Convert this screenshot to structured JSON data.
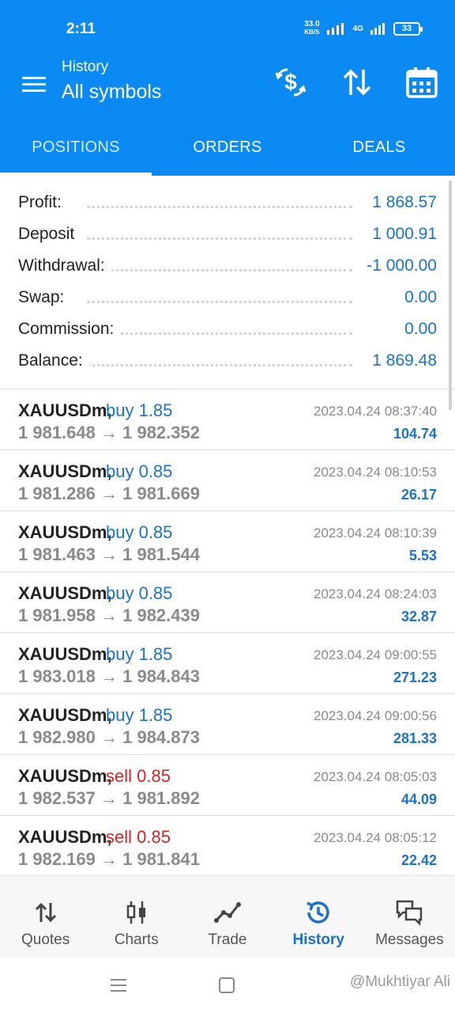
{
  "status_bar": {
    "time": "2:11",
    "net_speed": "33.0",
    "net_unit": "KB/S",
    "network": "4G",
    "battery": "33"
  },
  "app_bar": {
    "subtitle": "History",
    "title": "All symbols",
    "icons": [
      "menu-icon",
      "currency-exchange-icon",
      "sort-icon",
      "calendar-icon"
    ]
  },
  "tabs": [
    {
      "label": "POSITIONS",
      "active": true
    },
    {
      "label": "ORDERS",
      "active": false
    },
    {
      "label": "DEALS",
      "active": false
    }
  ],
  "summary": [
    {
      "label": "Profit:",
      "value": "1 868.57"
    },
    {
      "label": "Deposit",
      "value": "1 000.91"
    },
    {
      "label": "Withdrawal:",
      "value": "-1 000.00"
    },
    {
      "label": "Swap:",
      "value": "0.00"
    },
    {
      "label": "Commission:",
      "value": "0.00"
    },
    {
      "label": "Balance:",
      "value": "1 869.48"
    }
  ],
  "deals": [
    {
      "symbol": "XAUUSDm,",
      "direction": "buy",
      "volume": "buy 1.85",
      "open": "1 981.648",
      "close": "1 982.352",
      "time": "2023.04.24 08:37:40",
      "profit": "104.74"
    },
    {
      "symbol": "XAUUSDm,",
      "direction": "buy",
      "volume": "buy 0.85",
      "open": "1 981.286",
      "close": "1 981.669",
      "time": "2023.04.24 08:10:53",
      "profit": "26.17"
    },
    {
      "symbol": "XAUUSDm,",
      "direction": "buy",
      "volume": "buy 0.85",
      "open": "1 981.463",
      "close": "1 981.544",
      "time": "2023.04.24 08:10:39",
      "profit": "5.53"
    },
    {
      "symbol": "XAUUSDm,",
      "direction": "buy",
      "volume": "buy 0.85",
      "open": "1 981.958",
      "close": "1 982.439",
      "time": "2023.04.24 08:24:03",
      "profit": "32.87"
    },
    {
      "symbol": "XAUUSDm,",
      "direction": "buy",
      "volume": "buy 1.85",
      "open": "1 983.018",
      "close": "1 984.843",
      "time": "2023.04.24 09:00:55",
      "profit": "271.23"
    },
    {
      "symbol": "XAUUSDm,",
      "direction": "buy",
      "volume": "buy 1.85",
      "open": "1 982.980",
      "close": "1 984.873",
      "time": "2023.04.24 09:00:56",
      "profit": "281.33"
    },
    {
      "symbol": "XAUUSDm,",
      "direction": "sell",
      "volume": "sell 0.85",
      "open": "1 982.537",
      "close": "1 981.892",
      "time": "2023.04.24 08:05:03",
      "profit": "44.09"
    },
    {
      "symbol": "XAUUSDm,",
      "direction": "sell",
      "volume": "sell 0.85",
      "open": "1 982.169",
      "close": "1 981.841",
      "time": "2023.04.24 08:05:12",
      "profit": "22.42"
    }
  ],
  "bottom_nav": [
    {
      "label": "Quotes",
      "icon": "quotes-arrows-icon",
      "active": false
    },
    {
      "label": "Charts",
      "icon": "candlestick-icon",
      "active": false
    },
    {
      "label": "Trade",
      "icon": "trade-line-icon",
      "active": false
    },
    {
      "label": "History",
      "icon": "history-clock-icon",
      "active": true
    },
    {
      "label": "Messages",
      "icon": "chat-bubbles-icon",
      "active": false
    }
  ],
  "watermark": "@Mukhtiyar Ali",
  "colors": {
    "primary": "#0a8af2",
    "profit": "#1a73c8",
    "sell": "#d32626",
    "muted": "#8a8a8a"
  }
}
